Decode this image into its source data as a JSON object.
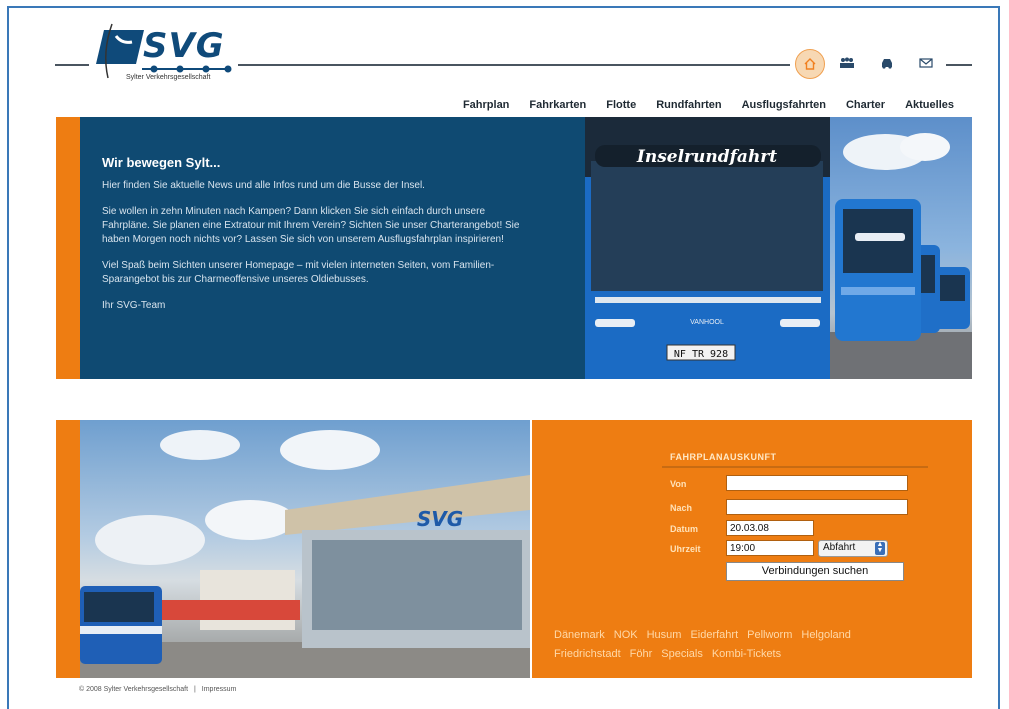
{
  "header": {
    "logo_text": "SVG",
    "logo_subtitle": "Sylter Verkehrsgesellschaft",
    "icons": [
      "home-icon",
      "group-icon",
      "car-icon",
      "mail-icon"
    ]
  },
  "nav": [
    "Fahrplan",
    "Fahrkarten",
    "Flotte",
    "Rundfahrten",
    "Ausflugsfahrten",
    "Charter",
    "Aktuelles"
  ],
  "hero": {
    "title": "Wir bewegen Sylt...",
    "paragraphs": [
      "Hier finden Sie aktuelle News und alle Infos rund um die Busse der Insel.",
      "Sie wollen in zehn Minuten nach Kampen? Dann klicken Sie sich einfach durch unsere Fahrpläne. Sie planen eine Extratour mit Ihrem Verein? Sichten Sie unser Charterangebot! Sie haben Morgen noch nichts vor? Lassen Sie sich von unserem Ausflugsfahrplan inspirieren!",
      "Viel Spaß beim Sichten unserer Homepage – mit vielen interneten Seiten, vom Familien-Sparangebot bis zur Charmeoffensive unseres Oldiebusses.",
      "Ihr SVG-Team"
    ],
    "bus_banner": "Inselrundfahrt",
    "bus_plate": "NF TR 928",
    "bus_brand": "VANHOOL"
  },
  "station_sign": "SVG",
  "fahrplan": {
    "title": "FAHRPLANAUSKUNFT",
    "von_label": "Von",
    "nach_label": "Nach",
    "datum_label": "Datum",
    "uhrzeit_label": "Uhrzeit",
    "von_value": "",
    "nach_value": "",
    "datum_value": "20.03.08",
    "uhrzeit_value": "19:00",
    "mode_value": "Abfahrt",
    "submit_label": "Verbindungen suchen"
  },
  "quick_links": [
    "Dänemark",
    "NOK",
    "Husum",
    "Eiderfahrt",
    "Pellworm",
    "Helgoland",
    "Friedrichstadt",
    "Föhr",
    "Specials",
    "Kombi-Tickets"
  ],
  "footer": {
    "copyright": "© 2008 Sylter Verkehrsgesellschaft",
    "separator": "|",
    "impressum": "Impressum"
  },
  "colors": {
    "orange": "#ee7d12",
    "navy": "#0f4a72",
    "bus_blue": "#1f6fc8"
  }
}
